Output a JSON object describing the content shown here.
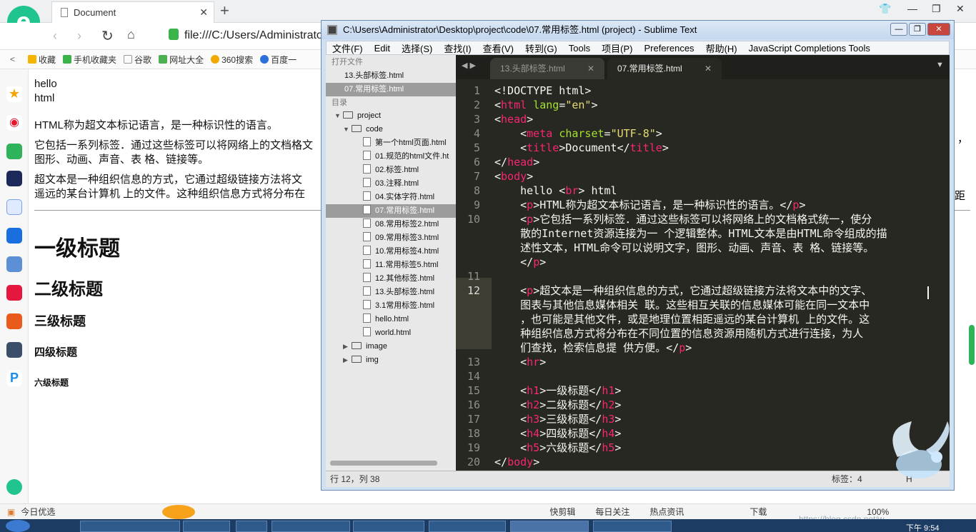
{
  "browser": {
    "logo": "e",
    "tab_title": "Document",
    "address": "file:///C:/Users/Administrator",
    "bookmarks": [
      "收藏",
      "手机收藏夹",
      "谷歌",
      "网址大全",
      "360搜索",
      "百度一"
    ],
    "status_left": "今日优选",
    "status_right": [
      "快剪辑",
      "每日关注",
      "热点资讯",
      "下载",
      "100%"
    ],
    "watermark": "https://blog.csdn.net/w..."
  },
  "page": {
    "line1": "hello",
    "line2": "html",
    "p1": "HTML称为超文本标记语言，是一种标识性的语言。",
    "p2": "它包括一系列标签．通过这些标签可以将网络上的文档格文",
    "p2b": "图形、动画、声音、表 格、链接等。",
    "p3": "超文本是一种组织信息的方式，它通过超级链接方法将文",
    "p3b": "遥远的某台计算机 上的文件。这种组织信息方式将分布在",
    "h1": "一级标题",
    "h2": "二级标题",
    "h3": "三级标题",
    "h4": "四级标题",
    "h5": "六级标题"
  },
  "sublime": {
    "title": "C:\\Users\\Administrator\\Desktop\\project\\code\\07.常用标签.html (project) - Sublime Text",
    "menu": [
      "文件(F)",
      "Edit",
      "选择(S)",
      "查找(I)",
      "查看(V)",
      "转到(G)",
      "Tools",
      "项目(P)",
      "Preferences",
      "帮助(H)",
      "JavaScript Completions Tools"
    ],
    "open_files_label": "打开文件",
    "open_files": [
      "13.头部标签.html",
      "07.常用标签.html"
    ],
    "dir_label": "目录",
    "tree": [
      "project",
      "code",
      "第一个html页面.html",
      "01.规范的html文件.ht",
      "02.标签.html",
      "03.注释.html",
      "04.实体字符.html",
      "07.常用标签.html",
      "08.常用标签2.html",
      "09.常用标签3.html",
      "10.常用标签4.html",
      "11.常用标签5.html",
      "12.其他标签.html",
      "13.头部标签.html",
      "3.1常用标签.html",
      "hello.html",
      "world.html",
      "image",
      "img"
    ],
    "tabs": [
      "13.头部标签.html",
      "07.常用标签.html"
    ],
    "status_left": "行 12，列 38",
    "status_right": "标签：4",
    "status_far": "H"
  },
  "code": {
    "l1": "<!DOCTYPE html>",
    "l9": "HTML称为超文本标记语言，是一种标识性的语言。",
    "l10a": "它包括一系列标签．通过这些标签可以将网络上的文档格式统一，使分",
    "l10b": "散的Internet资源连接为一 个逻辑整体。HTML文本是由HTML命令组成的描",
    "l10c": "述性文本，HTML命令可以说明文字，图形、动画、声音、表 格、链接等。",
    "l12a": "超文本是一种组织信息的方式，它通过超级链接方法将文本中的文字、",
    "l12b": "图表与其他信息媒体相关 联。这些相互关联的信息媒体可能在同一文本中",
    "l12c": "，也可能是其他文件，或是地理位置相距遥远的某台计算机 上的文件。这",
    "l12d": "种组织信息方式将分布在不同位置的信息资源用随机方式进行连接，为人",
    "l12e": "们查找，检索信息提 供方便。",
    "h1": "一级标题",
    "h2": "二级标题",
    "h3": "三级标题",
    "h4": "四级标题",
    "h5": "六级标题"
  },
  "taskbar": {
    "clock": "下午 9:54"
  }
}
